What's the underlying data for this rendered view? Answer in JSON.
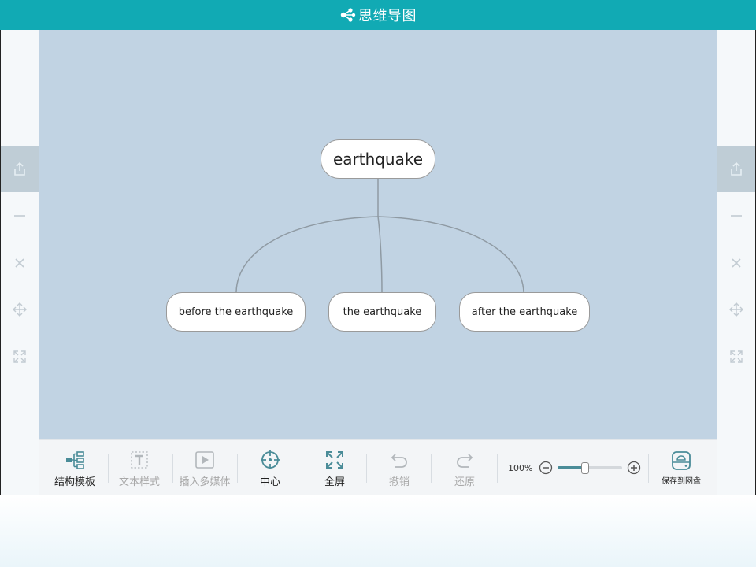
{
  "app": {
    "title": "思维导图"
  },
  "colors": {
    "accent": "#11aab4",
    "canvas": "#c1d3e3",
    "node_border": "#9a9a9a",
    "line": "#8f9aa3"
  },
  "mindmap": {
    "root": {
      "label": "earthquake"
    },
    "children": [
      {
        "label": "before the earthquake"
      },
      {
        "label": "the earthquake"
      },
      {
        "label": "after the earthquake"
      }
    ]
  },
  "side_tools": [
    "export-icon",
    "minimize-icon",
    "close-icon",
    "move-icon",
    "expand-icon"
  ],
  "toolbar": {
    "structure_label": "结构模板",
    "text_style_label": "文本样式",
    "insert_media_label": "插入多媒体",
    "center_label": "中心",
    "fullscreen_label": "全屏",
    "undo_label": "撤销",
    "redo_label": "还原",
    "save_label": "保存到网盘"
  },
  "zoom": {
    "label": "100%",
    "level": 0.42
  }
}
